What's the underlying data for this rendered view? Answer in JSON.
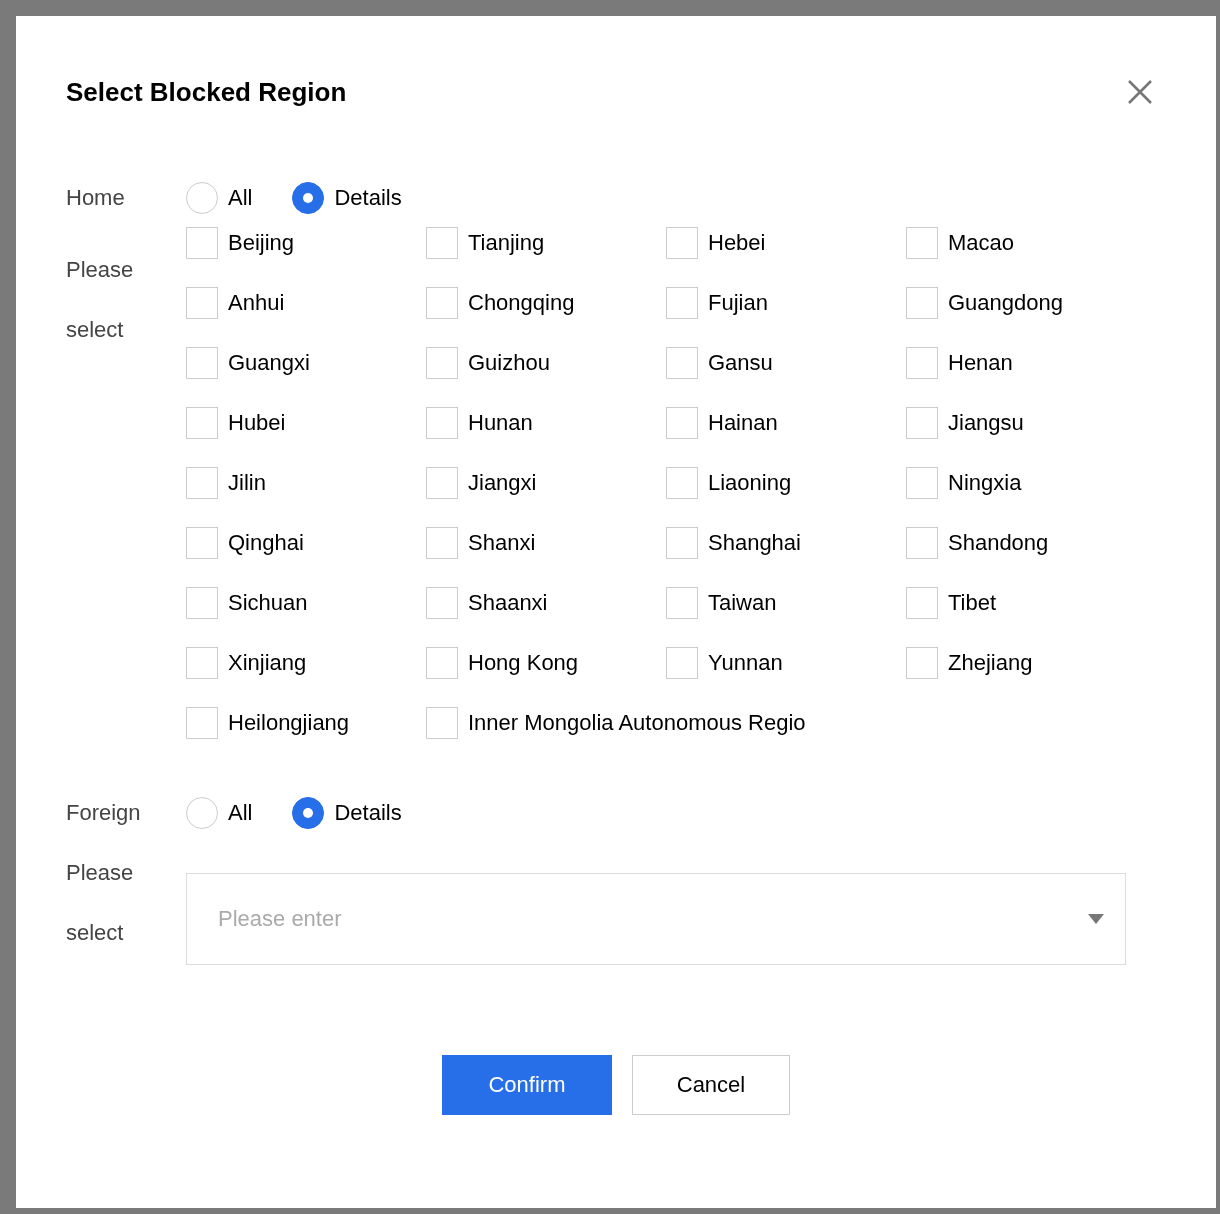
{
  "dialog": {
    "title": "Select Blocked Region"
  },
  "home": {
    "label": "Home",
    "radios": [
      {
        "label": "All",
        "selected": false
      },
      {
        "label": "Details",
        "selected": true
      }
    ],
    "prompt": "Please select",
    "regions": [
      {
        "label": "Beijing",
        "checked": false
      },
      {
        "label": "Tianjing",
        "checked": false
      },
      {
        "label": "Hebei",
        "checked": false
      },
      {
        "label": "Macao",
        "checked": false
      },
      {
        "label": "Anhui",
        "checked": false
      },
      {
        "label": "Chongqing",
        "checked": false
      },
      {
        "label": "Fujian",
        "checked": false
      },
      {
        "label": "Guangdong",
        "checked": false
      },
      {
        "label": "Guangxi",
        "checked": false
      },
      {
        "label": "Guizhou",
        "checked": false
      },
      {
        "label": "Gansu",
        "checked": false
      },
      {
        "label": "Henan",
        "checked": false
      },
      {
        "label": "Hubei",
        "checked": false
      },
      {
        "label": "Hunan",
        "checked": false
      },
      {
        "label": "Hainan",
        "checked": false
      },
      {
        "label": "Jiangsu",
        "checked": false
      },
      {
        "label": "Jilin",
        "checked": false
      },
      {
        "label": "Jiangxi",
        "checked": false
      },
      {
        "label": "Liaoning",
        "checked": false
      },
      {
        "label": "Ningxia",
        "checked": false
      },
      {
        "label": "Qinghai",
        "checked": false
      },
      {
        "label": "Shanxi",
        "checked": false
      },
      {
        "label": "Shanghai",
        "checked": false
      },
      {
        "label": "Shandong",
        "checked": false
      },
      {
        "label": "Sichuan",
        "checked": false
      },
      {
        "label": "Shaanxi",
        "checked": false
      },
      {
        "label": "Taiwan",
        "checked": false
      },
      {
        "label": "Tibet",
        "checked": false
      },
      {
        "label": "Xinjiang",
        "checked": false
      },
      {
        "label": "Hong Kong",
        "checked": false
      },
      {
        "label": "Yunnan",
        "checked": false
      },
      {
        "label": "Zhejiang",
        "checked": false
      },
      {
        "label": "Heilongjiang",
        "checked": false
      },
      {
        "label": "Inner Mongolia Autonomous Regio",
        "checked": false
      }
    ]
  },
  "foreign": {
    "label": "Foreign",
    "radios": [
      {
        "label": "All",
        "selected": false
      },
      {
        "label": "Details",
        "selected": true
      }
    ],
    "prompt": "Please select",
    "select": {
      "placeholder": "Please enter"
    }
  },
  "buttons": [
    {
      "label": "Confirm",
      "kind": "primary"
    },
    {
      "label": "Cancel",
      "kind": "secondary"
    }
  ]
}
